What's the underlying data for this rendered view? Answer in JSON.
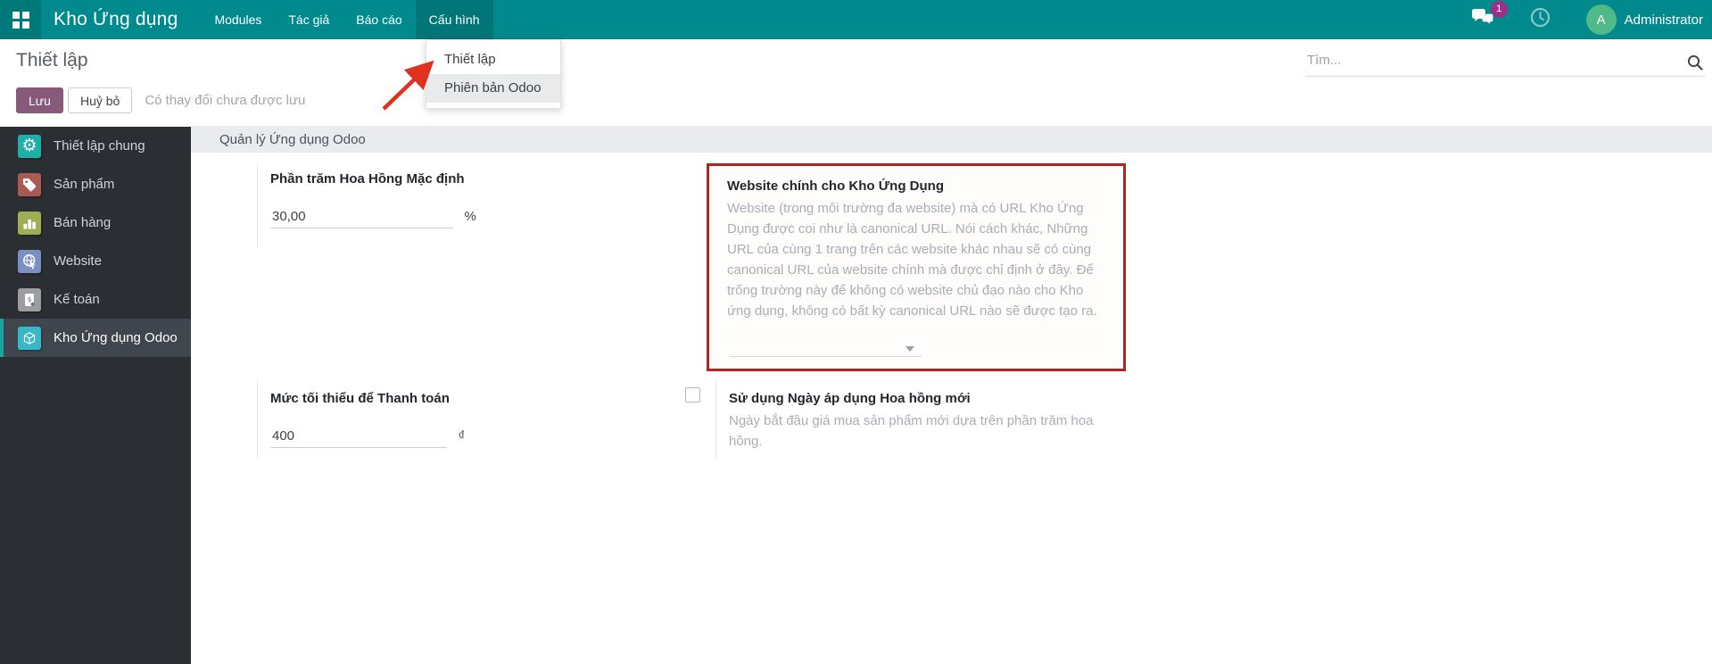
{
  "navbar": {
    "brand": "Kho Ứng dụng",
    "menus": [
      "Modules",
      "Tác giả",
      "Báo cáo",
      "Cấu hình"
    ],
    "active_menu": "Cấu hình",
    "messages_badge": "1",
    "user_initial": "A",
    "user_name": "Administrator"
  },
  "dropdown": {
    "items": [
      "Thiết lập",
      "Phiên bản Odoo"
    ]
  },
  "control_panel": {
    "title": "Thiết lập",
    "save_label": "Lưu",
    "discard_label": "Huỷ bỏ",
    "status": "Có thay đổi chưa được lưu",
    "search_placeholder": "Tìm..."
  },
  "sidebar": {
    "items": [
      {
        "label": "Thiết lập chung",
        "icon": "gear-icon",
        "color": "#1eafa6"
      },
      {
        "label": "Sản phẩm",
        "icon": "tag-icon",
        "color": "#a85a53"
      },
      {
        "label": "Bán hàng",
        "icon": "bar-chart-icon",
        "color": "#9fad55"
      },
      {
        "label": "Website",
        "icon": "globe-icon",
        "color": "#7b8fc3"
      },
      {
        "label": "Kế toán",
        "icon": "invoice-icon",
        "color": "#9b9da0"
      },
      {
        "label": "Kho Ứng dụng Odoo",
        "icon": "cube-icon",
        "color": "#39b7c6",
        "selected": true
      }
    ]
  },
  "content": {
    "section_title": "Quản lý Ứng dụng Odoo",
    "settings": [
      {
        "label": "Phần trăm Hoa Hồng Mặc định",
        "value": "30,00",
        "suffix": "%"
      },
      {
        "label": "Website chính cho Kho Ứng Dụng",
        "help": "Website (trong môi trường đa website) mà có URL Kho Ứng Dụng được coi như là canonical URL. Nói cách khác, Những URL của cùng 1 trang trên các website khác nhau sẽ có cùng canonical URL của website chính mà được chỉ định ở đây. Để trống trường này để không có website chủ đạo nào cho Kho ứng dụng, không có bất kỳ canonical URL nào sẽ được tạo ra.",
        "value": "",
        "highlighted": true
      },
      {
        "label": "Mức tối thiểu để Thanh toán",
        "value": "400",
        "suffix": "₫"
      },
      {
        "label": "Sử dụng Ngày áp dụng Hoa hồng mới",
        "help": "Ngày bắt đầu giá mua sản phẩm mới dựa trên phần trăm hoa hồng.",
        "checked": false
      }
    ]
  },
  "colors": {
    "navbar_teal": "#008a8d",
    "save_purple": "#875a7b",
    "highlight_red": "#b4231f",
    "arrow_red": "#e0301e",
    "badge_magenta": "#9c3088",
    "avatar_green": "#4fba87",
    "sidebar_dark": "#2b2f33",
    "section_bar_gray": "#e9ebee"
  }
}
